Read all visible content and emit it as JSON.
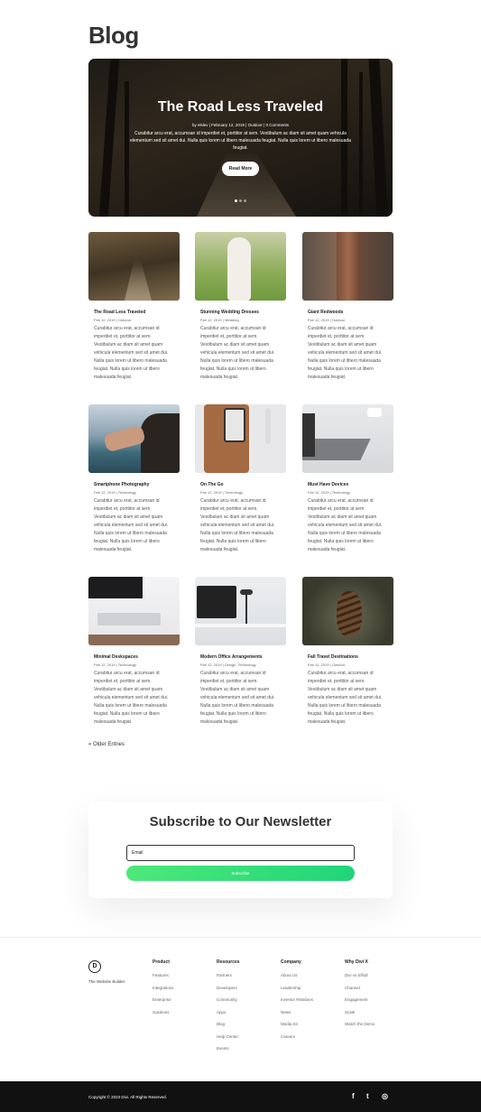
{
  "page": {
    "title": "Blog"
  },
  "hero": {
    "title": "The Road Less Traveled",
    "meta": "by elslev | February 12, 2019 | Outdoor | 0 Comments",
    "excerpt": "Curabitur arcu erat, accumsan id imperdiet et, porttitor at sem. Vestibulum ac diam sit amet quam vehicula elementum sed sit amet dui. Nulla quis lorem ut libero malesuada feugiat. Nulla quis lorem ut libero malesuada feugiat.",
    "button": "Read More"
  },
  "posts": [
    {
      "title": "The Road Less Traveled",
      "meta": "Feb 12, 2019 | Outdoor",
      "excerpt": "Curabitur arcu erat, accumsan id imperdiet et, porttitor at sem. Vestibulum ac diam sit amet quam vehicula elementum sed sit amet dui. Nulla quis lorem ut libero malesuada feugiat. Nulla quis lorem ut libero malesuada feugiat."
    },
    {
      "title": "Stunning Wedding Dresses",
      "meta": "Feb 12, 2019 | Wedding",
      "excerpt": "Curabitur arcu erat, accumsan id imperdiet et, porttitor at sem. Vestibulum ac diam sit amet quam vehicula elementum sed sit amet dui. Nulla quis lorem ut libero malesuada feugiat. Nulla quis lorem ut libero malesuada feugiat."
    },
    {
      "title": "Giant Redwoods",
      "meta": "Feb 12, 2019 | Outdoor",
      "excerpt": "Curabitur arcu erat, accumsan id imperdiet et, porttitor at sem. Vestibulum ac diam sit amet quam vehicula elementum sed sit amet dui. Nulla quis lorem ut libero malesuada feugiat. Nulla quis lorem ut libero malesuada feugiat."
    },
    {
      "title": "Smartphone Photography",
      "meta": "Feb 12, 2019 | Technology",
      "excerpt": "Curabitur arcu erat, accumsan id imperdiet et, porttitor at sem. Vestibulum ac diam sit amet quam vehicula elementum sed sit amet dui. Nulla quis lorem ut libero malesuada feugiat. Nulla quis lorem ut libero malesuada feugiat."
    },
    {
      "title": "On The Go",
      "meta": "Feb 12, 2019 | Technology",
      "excerpt": "Curabitur arcu erat, accumsan id imperdiet et, porttitor at sem. Vestibulum ac diam sit amet quam vehicula elementum sed sit amet dui. Nulla quis lorem ut libero malesuada feugiat. Nulla quis lorem ut libero malesuada feugiat."
    },
    {
      "title": "Must Have Devices",
      "meta": "Feb 12, 2019 | Technology",
      "excerpt": "Curabitur arcu erat, accumsan id imperdiet et, porttitor at sem. Vestibulum ac diam sit amet quam vehicula elementum sed sit amet dui. Nulla quis lorem ut libero malesuada feugiat. Nulla quis lorem ut libero malesuada feugiat."
    },
    {
      "title": "Minimal Deskspaces",
      "meta": "Feb 12, 2019 | Technology",
      "excerpt": "Curabitur arcu erat, accumsan id imperdiet et, porttitor at sem. Vestibulum ac diam sit amet quam vehicula elementum sed sit amet dui. Nulla quis lorem ut libero malesuada feugiat. Nulla quis lorem ut libero malesuada feugiat."
    },
    {
      "title": "Modern Office Arrangements",
      "meta": "Feb 12, 2019 | Design, Technology",
      "excerpt": "Curabitur arcu erat, accumsan id imperdiet et, porttitor at sem. Vestibulum ac diam sit amet quam vehicula elementum sed sit amet dui. Nulla quis lorem ut libero malesuada feugiat. Nulla quis lorem ut libero malesuada feugiat."
    },
    {
      "title": "Fall Travel Destinations",
      "meta": "Feb 12, 2019 | Outdoor",
      "excerpt": "Curabitur arcu erat, accumsan id imperdiet et, porttitor at sem. Vestibulum ac diam sit amet quam vehicula elementum sed sit amet dui. Nulla quis lorem ut libero malesuada feugiat. Nulla quis lorem ut libero malesuada feugiat."
    }
  ],
  "pagination": {
    "older": "« Older Entries"
  },
  "newsletter": {
    "title": "Subscribe to Our Newsletter",
    "email_placeholder": "Email",
    "button": "Subscribe"
  },
  "footer": {
    "logo": "D",
    "tagline": "The Website Builder",
    "columns": [
      {
        "heading": "Product",
        "links": [
          "Features",
          "Integrations",
          "Enterprise",
          "Solutions"
        ]
      },
      {
        "heading": "Resources",
        "links": [
          "Partners",
          "Developers",
          "Community",
          "Apps",
          "Blog",
          "Help Center",
          "Events"
        ]
      },
      {
        "heading": "Company",
        "links": [
          "About Us",
          "Leadership",
          "Investor Relations",
          "News",
          "Media Kit",
          "Careers"
        ]
      },
      {
        "heading": "Why Divi X",
        "links": [
          "Divi vs Elfsdl",
          "Channel",
          "Engagement",
          "Scale",
          "Watch the Demo"
        ]
      }
    ],
    "copyright": "Copyright © 2023 Divi. All Rights Reserved.",
    "social": {
      "facebook": "f",
      "twitter": "t",
      "instagram": "◎"
    }
  },
  "colors": {
    "accent": "#2edb79",
    "dark": "#111111",
    "text": "#333333"
  }
}
